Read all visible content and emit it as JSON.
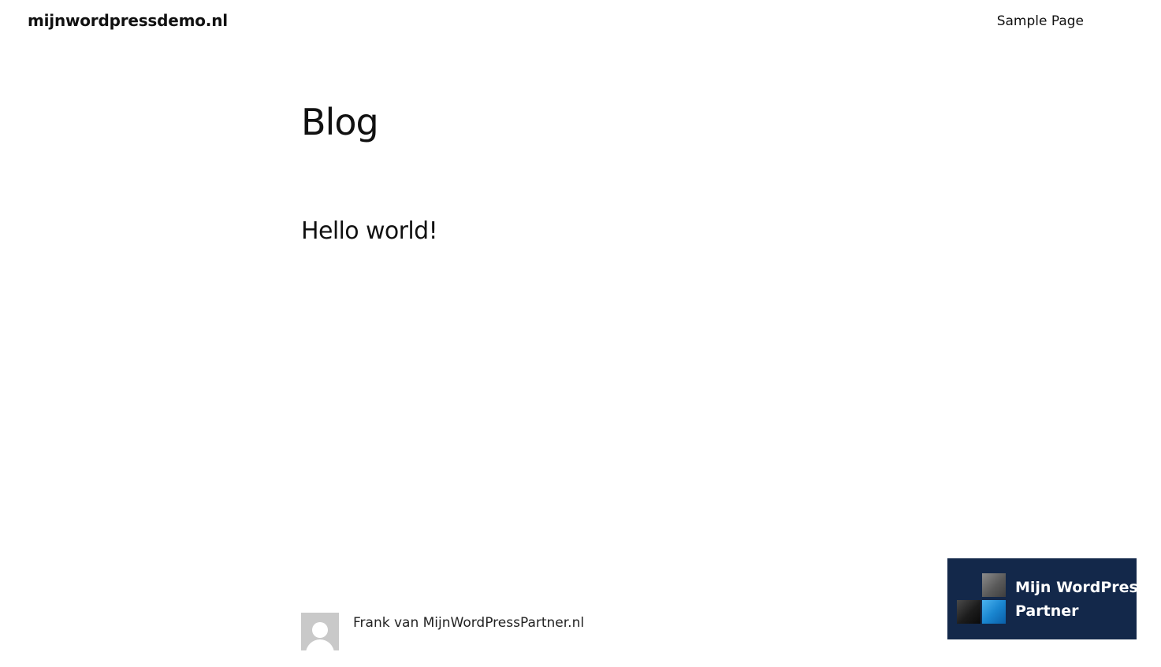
{
  "header": {
    "site_title": "mijnwordpressdemo.nl",
    "nav": [
      {
        "label": "Sample Page"
      }
    ]
  },
  "main": {
    "page_title": "Blog",
    "posts": [
      {
        "title": "Hello world!"
      }
    ],
    "author": {
      "name": "Frank van MijnWordPressPartner.nl",
      "avatar_icon": "default-user-avatar-icon"
    }
  },
  "badge": {
    "line1": "Mijn WordPress",
    "line2": "Partner",
    "background_color": "#13284a",
    "logo_icon": "partner-logo-icon"
  }
}
